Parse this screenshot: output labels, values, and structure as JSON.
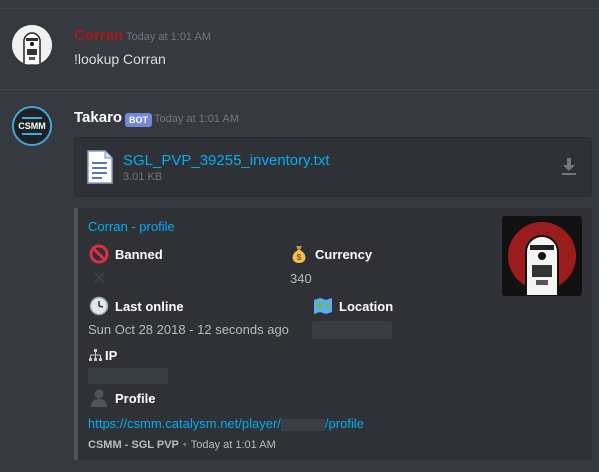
{
  "messages": [
    {
      "username": "Corran",
      "timestamp": "Today at 1:01 AM",
      "text": "!lookup Corran",
      "username_color": "#a71a1a"
    },
    {
      "username": "Takaro",
      "badge": "BOT",
      "timestamp": "Today at 1:01 AM",
      "avatar_text": "CSMM"
    }
  ],
  "attachment": {
    "filename": "SGL_PVP_39255_inventory.txt",
    "size": "3.01 KB"
  },
  "embed": {
    "title": "Corran - profile",
    "fields": {
      "banned": {
        "name": "Banned",
        "value": "✕",
        "icon": "no-entry-icon"
      },
      "currency": {
        "name": "Currency",
        "value": "340",
        "icon": "money-bag-icon"
      },
      "last_online": {
        "name": "Last online",
        "value": "Sun Oct 28 2018 - 12 seconds ago",
        "icon": "clock-icon"
      },
      "location": {
        "name": "Location",
        "value": "",
        "icon": "map-icon"
      },
      "ip": {
        "name": "IP",
        "value": "",
        "icon": "network-icon"
      },
      "profile": {
        "name": "Profile",
        "icon": "person-silhouette-icon"
      }
    },
    "link_prefix": "https://csmm.catalysm.net/player/",
    "link_suffix": "/profile",
    "footer_source": "CSMM - SGL PVP",
    "footer_time": "Today at 1:01 AM"
  },
  "colors": {
    "background": "#36393f",
    "link": "#00b0f4",
    "embed_bg": "#2f3136",
    "bot_badge": "#7289da"
  }
}
